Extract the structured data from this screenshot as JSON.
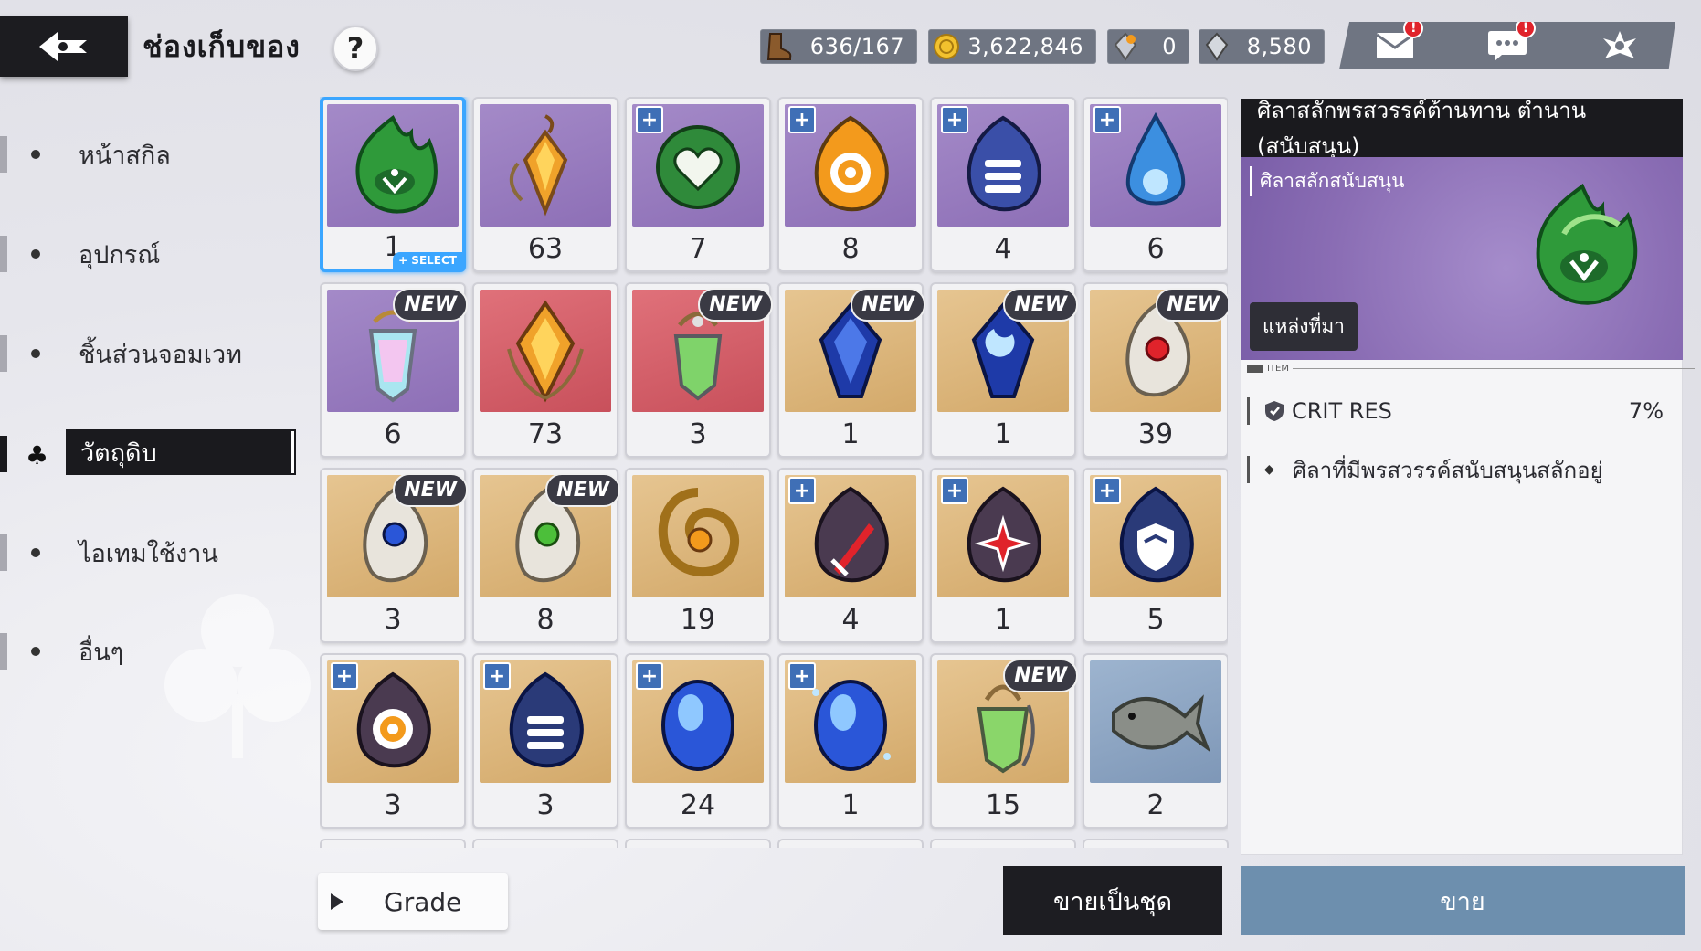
{
  "header": {
    "title": "ช่องเก็บของ",
    "help_label": "?"
  },
  "currencies": [
    {
      "icon": "boot-icon",
      "value": "636/167"
    },
    {
      "icon": "gold-coin-icon",
      "value": "3,622,846"
    },
    {
      "icon": "crystal-orange-icon",
      "value": "0"
    },
    {
      "icon": "crystal-gray-icon",
      "value": "8,580"
    }
  ],
  "top_icons": [
    {
      "icon": "mail-icon",
      "alert": "!"
    },
    {
      "icon": "chat-icon",
      "alert": "!"
    },
    {
      "icon": "guild-emblem-icon"
    }
  ],
  "sidebar": {
    "items": [
      {
        "label": "หน้าสกิล"
      },
      {
        "label": "อุปกรณ์"
      },
      {
        "label": "ชิ้นส่วนจอมเวท"
      },
      {
        "label": "วัตถุดิบ"
      },
      {
        "label": "ไอเทมใช้งาน"
      },
      {
        "label": "อื่นๆ"
      }
    ]
  },
  "grid": {
    "select_tag": "+ SELECT",
    "new_label": "NEW",
    "plus_label": "+",
    "items": [
      {
        "count": "1",
        "bg": "purple",
        "icon": "green-leaf-stone-icon"
      },
      {
        "count": "63",
        "bg": "purple",
        "icon": "amber-pendant-icon"
      },
      {
        "count": "7",
        "bg": "purple",
        "icon": "heart-stone-icon"
      },
      {
        "count": "8",
        "bg": "purple",
        "icon": "target-stone-icon"
      },
      {
        "count": "4",
        "bg": "purple",
        "icon": "list-stone-icon"
      },
      {
        "count": "6",
        "bg": "purple",
        "icon": "water-drop-icon"
      },
      {
        "count": "6",
        "bg": "purple",
        "icon": "crystal-pendant-icon"
      },
      {
        "count": "73",
        "bg": "red",
        "icon": "amber-crystal-icon"
      },
      {
        "count": "3",
        "bg": "red",
        "icon": "green-pendant-icon"
      },
      {
        "count": "1",
        "bg": "gold",
        "icon": "blue-gem-icon"
      },
      {
        "count": "1",
        "bg": "gold",
        "icon": "blue-moon-gem-icon"
      },
      {
        "count": "39",
        "bg": "gold",
        "icon": "red-orb-leaf-icon"
      },
      {
        "count": "3",
        "bg": "gold",
        "icon": "blue-orb-leaf-icon"
      },
      {
        "count": "8",
        "bg": "gold",
        "icon": "green-orb-leaf-icon"
      },
      {
        "count": "19",
        "bg": "gold",
        "icon": "swirl-orb-icon"
      },
      {
        "count": "4",
        "bg": "gold",
        "icon": "sword-stone-icon"
      },
      {
        "count": "1",
        "bg": "gold",
        "icon": "star-burst-stone-icon"
      },
      {
        "count": "5",
        "bg": "gold",
        "icon": "shield-stone-icon"
      },
      {
        "count": "3",
        "bg": "gold",
        "icon": "target-stone-dark-icon"
      },
      {
        "count": "3",
        "bg": "gold",
        "icon": "list-stone-dark-icon"
      },
      {
        "count": "24",
        "bg": "gold",
        "icon": "blue-egg-icon"
      },
      {
        "count": "1",
        "bg": "gold",
        "icon": "blue-egg-sparkle-icon"
      },
      {
        "count": "15",
        "bg": "gold",
        "icon": "green-crystal-pendant-icon"
      },
      {
        "count": "2",
        "bg": "blue",
        "icon": "fish-icon"
      }
    ]
  },
  "detail": {
    "title": "ศิลาสลักพรสวรรค์ต้านทาน ตำนาน (สนับสนุน)",
    "subtitle": "ศิลาสลักสนับสนุน",
    "source_label": "แหล่งที่มา",
    "item_tag": "ITEM",
    "stat_name": "CRIT RES",
    "stat_value": "7%",
    "description": "ศิลาที่มีพรสวรรค์สนับสนุนสลักอยู่"
  },
  "footer": {
    "grade_label": "Grade",
    "bulk_sell_label": "ขายเป็นชุด",
    "sell_label": "ขาย"
  },
  "colors": {
    "accent_select": "#3ba6ff",
    "panel_dark": "#1a1a1e",
    "sell_button": "#6d8fae",
    "currency_bar": "#6f7582"
  }
}
